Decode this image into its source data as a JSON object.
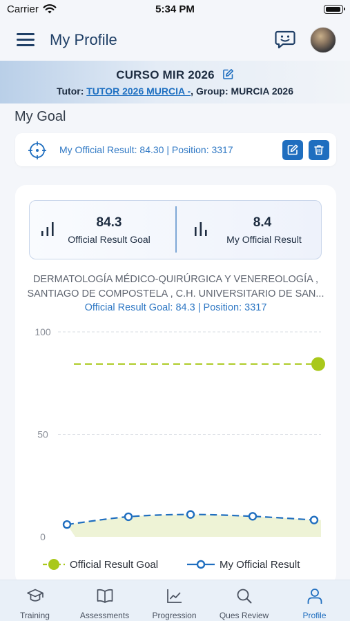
{
  "status_bar": {
    "carrier": "Carrier",
    "time": "5:34 PM"
  },
  "header": {
    "title": "My Profile",
    "menu_icon": "hamburger-menu-icon",
    "chat_icon": "chat-feedback-icon"
  },
  "course": {
    "title": "CURSO MIR 2026",
    "tutor_prefix": "Tutor: ",
    "tutor_link": "TUTOR 2026 MURCIA -",
    "group_text": ", Group: MURCIA 2026"
  },
  "goal_section": {
    "title": "My Goal",
    "summary": "My Official Result: 84.30 | Position: 3317"
  },
  "stats": [
    {
      "value": "84.3",
      "label": "Official Result Goal",
      "icon": "bar-chart-icon"
    },
    {
      "value": "8.4",
      "label": "My Official Result",
      "icon": "bar-chart-icon"
    }
  ],
  "goal_description": {
    "line1": "DERMATOLOGÍA MÉDICO-QUIRÚRGICA Y VENEREOLOGÍA ,",
    "line2": "SANTIAGO DE COMPOSTELA , C.H. UNIVERSITARIO DE SAN...",
    "sub": "Official Result Goal: 84.3 | Position: 3317"
  },
  "chart_data": {
    "type": "line",
    "ylim": [
      0,
      100
    ],
    "yticks": [
      "100",
      "50",
      "0"
    ],
    "grid": true,
    "legend_position": "bottom",
    "series": [
      {
        "name": "Official Result Goal",
        "color": "#a9c81b",
        "style": "dashed",
        "values": [
          84.3,
          84.3,
          84.3,
          84.3,
          84.3
        ]
      },
      {
        "name": "My Official Result",
        "color": "#1f6ebf",
        "style": "dashed",
        "values": [
          6,
          9.8,
          10.9,
          10,
          8.2
        ]
      }
    ]
  },
  "colors": {
    "accent": "#1f6ebf",
    "goal_line": "#a9c81b",
    "link": "#2f78c4"
  },
  "tabs": [
    {
      "label": "Training",
      "icon": "graduation-cap-icon"
    },
    {
      "label": "Assessments",
      "icon": "open-book-icon"
    },
    {
      "label": "Progression",
      "icon": "line-chart-icon"
    },
    {
      "label": "Ques Review",
      "icon": "search-icon"
    },
    {
      "label": "Profile",
      "icon": "person-icon"
    }
  ],
  "active_tab": "Profile"
}
